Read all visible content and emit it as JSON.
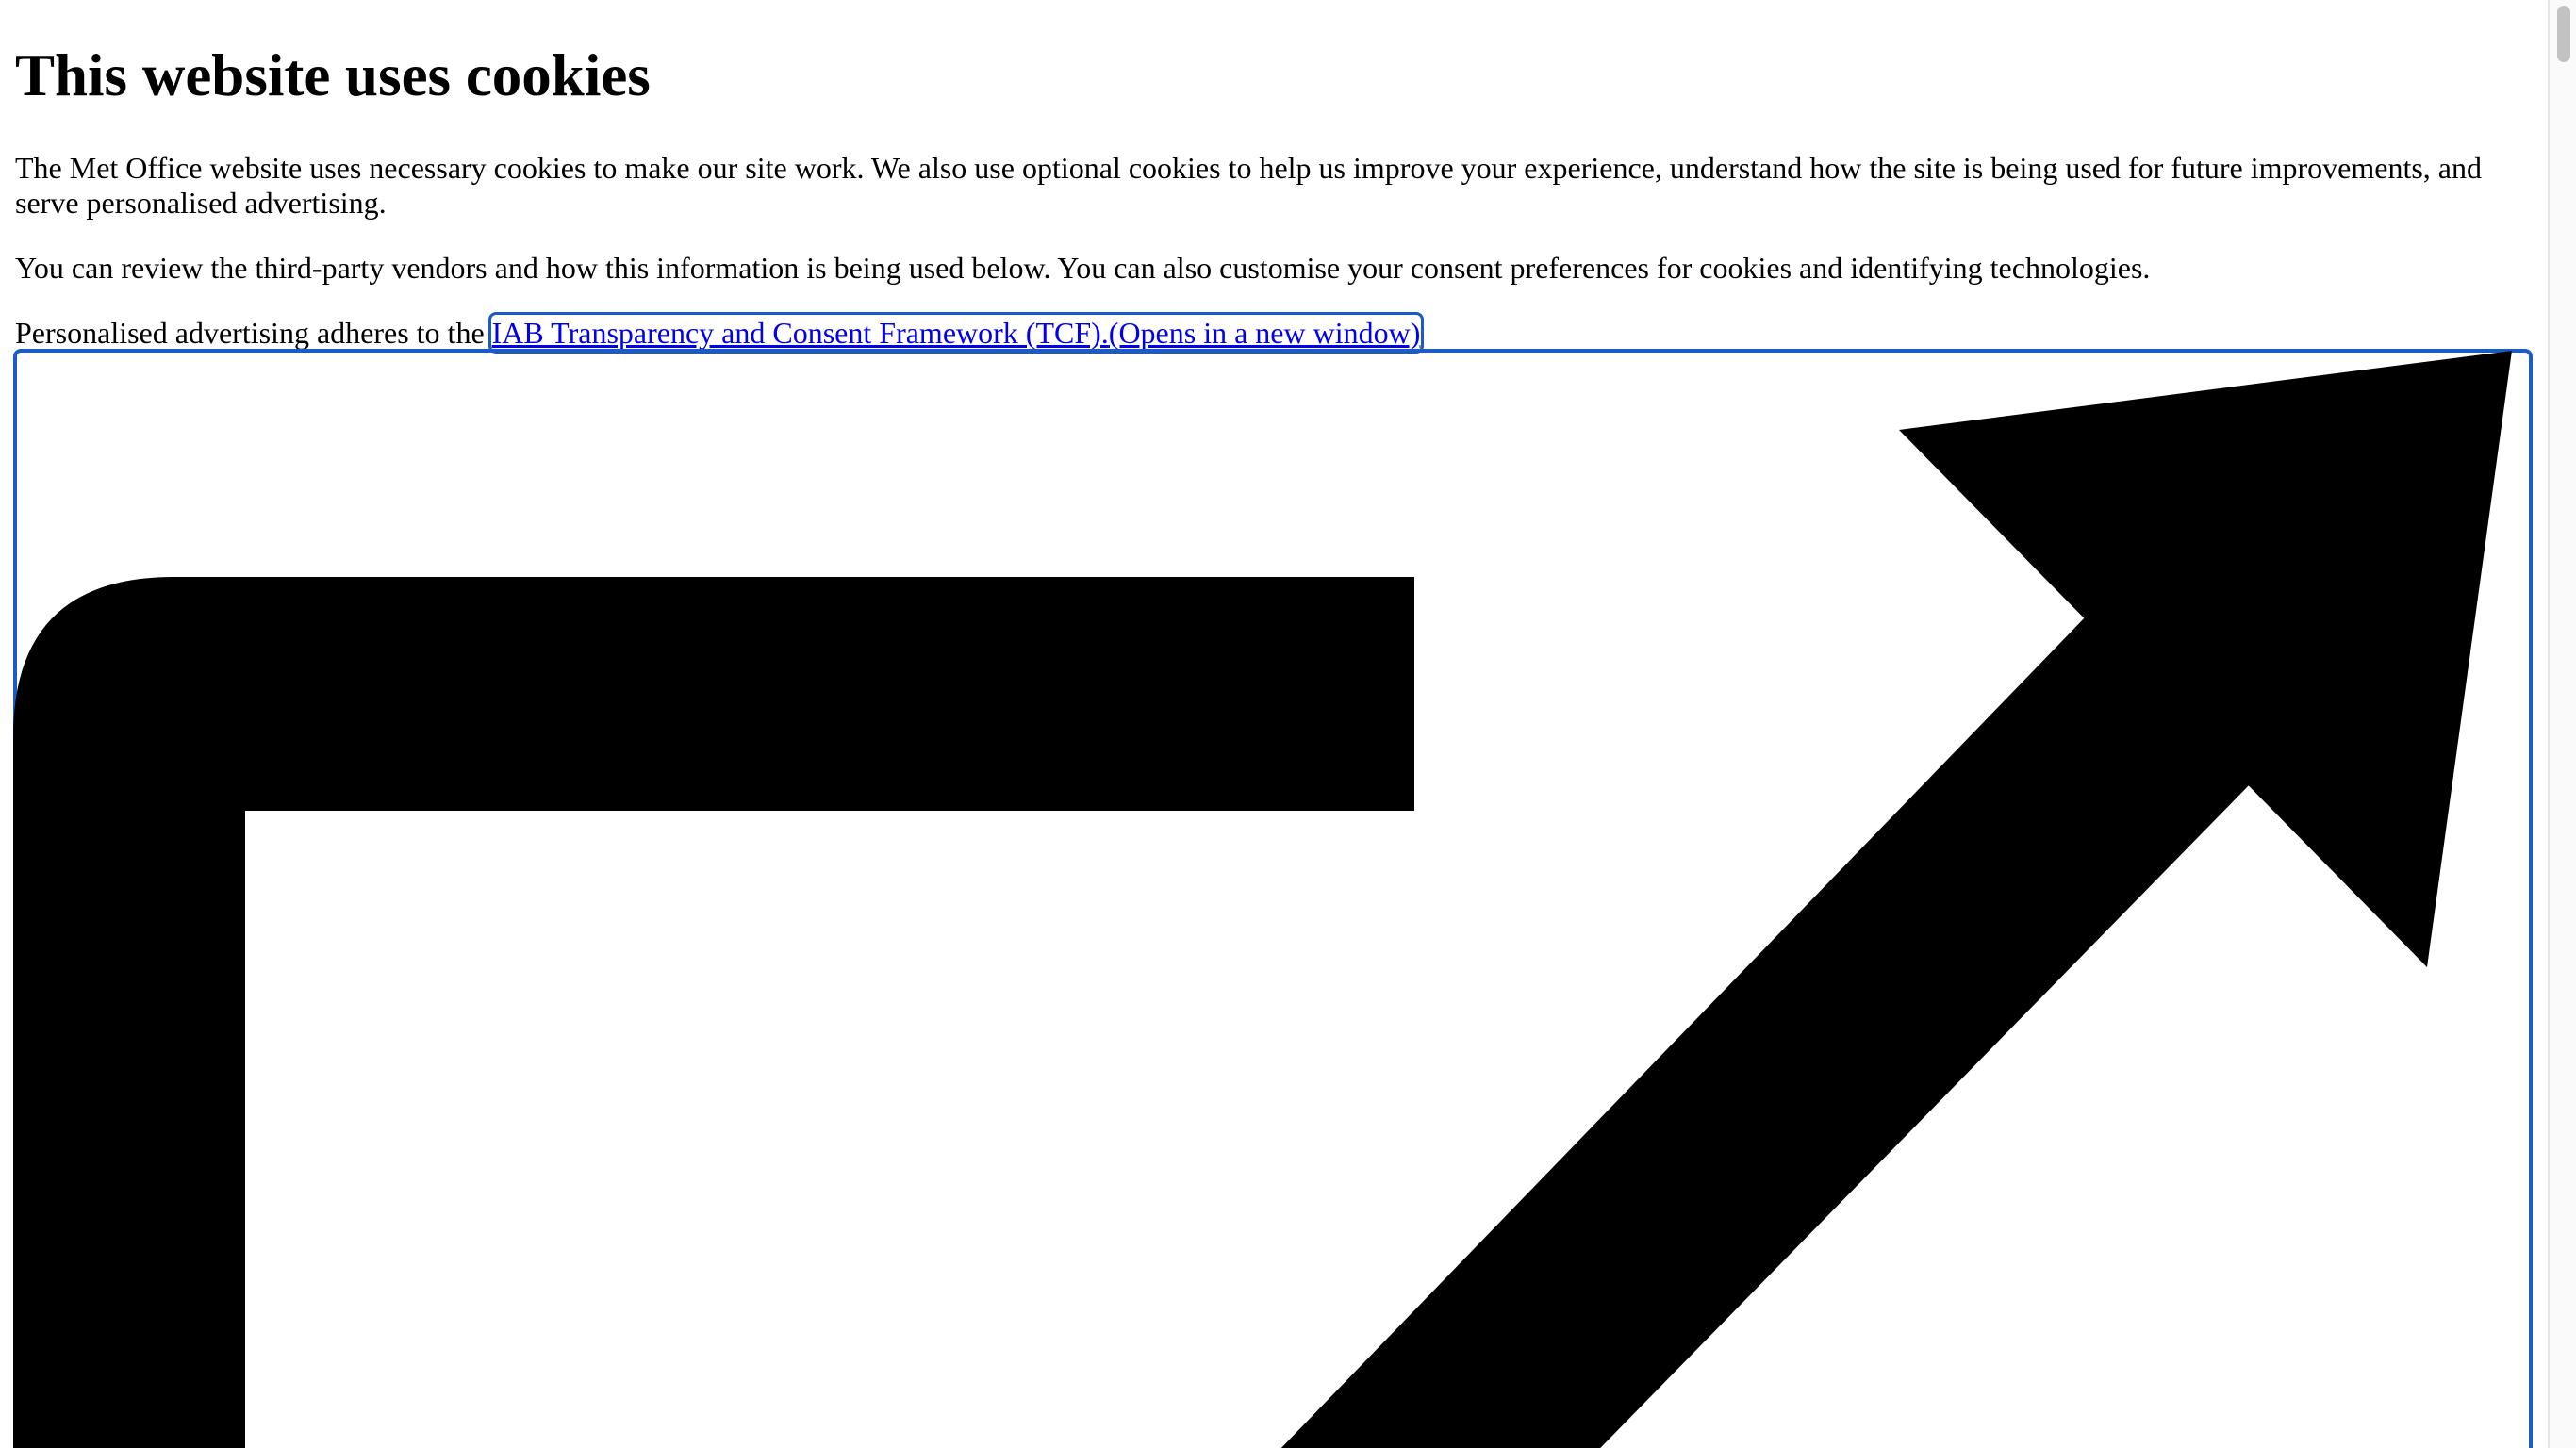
{
  "dialog": {
    "title": "This website uses cookies",
    "paragraph_1": "The Met Office website uses necessary cookies to make our site work. We also use optional cookies to help us improve your experience, understand how the site is being used for future improvements, and serve personalised advertising.",
    "paragraph_2": "You can review the third-party vendors and how this information is being used below. You can also customise your consent preferences for cookies and identifying technologies.",
    "paragraph_3_prefix": "Personalised advertising adheres to the ",
    "tcf_link_text": "IAB Transparency and Consent Framework (TCF).",
    "tcf_link_suffix": "(Opens in a new window)"
  },
  "icons": {
    "external_link": "external-link-icon"
  },
  "colors": {
    "link": "#0000ee",
    "focus_ring": "#1a5bc4"
  }
}
